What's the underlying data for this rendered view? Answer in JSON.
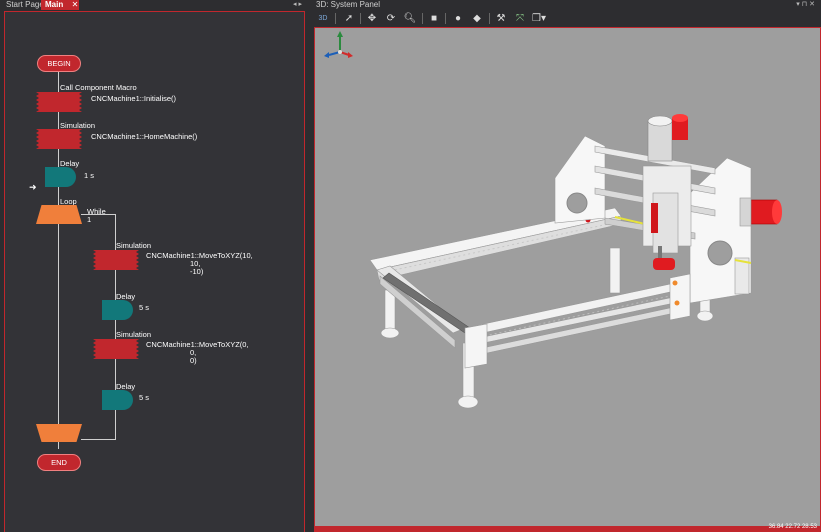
{
  "left_tabs": {
    "start_page": "Start Page",
    "main": "Main",
    "close": "✕",
    "controls": "◂ ▸"
  },
  "flowchart": {
    "begin": "BEGIN",
    "call_macro_title": "Call Component Macro",
    "call_macro_text": "CNCMachine1::Initialise()",
    "sim1_title": "Simulation",
    "sim1_text": "CNCMachine1::HomeMachine()",
    "delay1_title": "Delay",
    "delay1_text": "1 s",
    "loop_title": "Loop",
    "loop_cond": "While",
    "loop_value": "1",
    "sim2_title": "Simulation",
    "sim2_text": [
      "CNCMachine1::MoveToXYZ(10,",
      "10,",
      "-10)"
    ],
    "delay2_title": "Delay",
    "delay2_text": "5 s",
    "sim3_title": "Simulation",
    "sim3_text": [
      "CNCMachine1::MoveToXYZ(0,",
      "0,",
      "0)"
    ],
    "delay3_title": "Delay",
    "delay3_text": "5 s",
    "end": "END",
    "current_marker": "➜"
  },
  "system_panel": {
    "title": "3D: System Panel",
    "controls": "▾ ⊓ ✕",
    "toolbar_3d_label": "3D",
    "coords": "36.84   22.72   28.53"
  },
  "colors": {
    "accent": "#c1272d",
    "macro": "#c1272d",
    "delay": "#12787a",
    "loop": "#f07f3b",
    "viewport_bg": "#9e9e9e"
  },
  "icons": [
    "pointer-icon",
    "pan-icon",
    "orbit-icon",
    "zoom-icon",
    "camera-icon",
    "snapshot-icon",
    "cube-view-icon",
    "wrench-icon",
    "axis-icon",
    "layers-icon"
  ]
}
